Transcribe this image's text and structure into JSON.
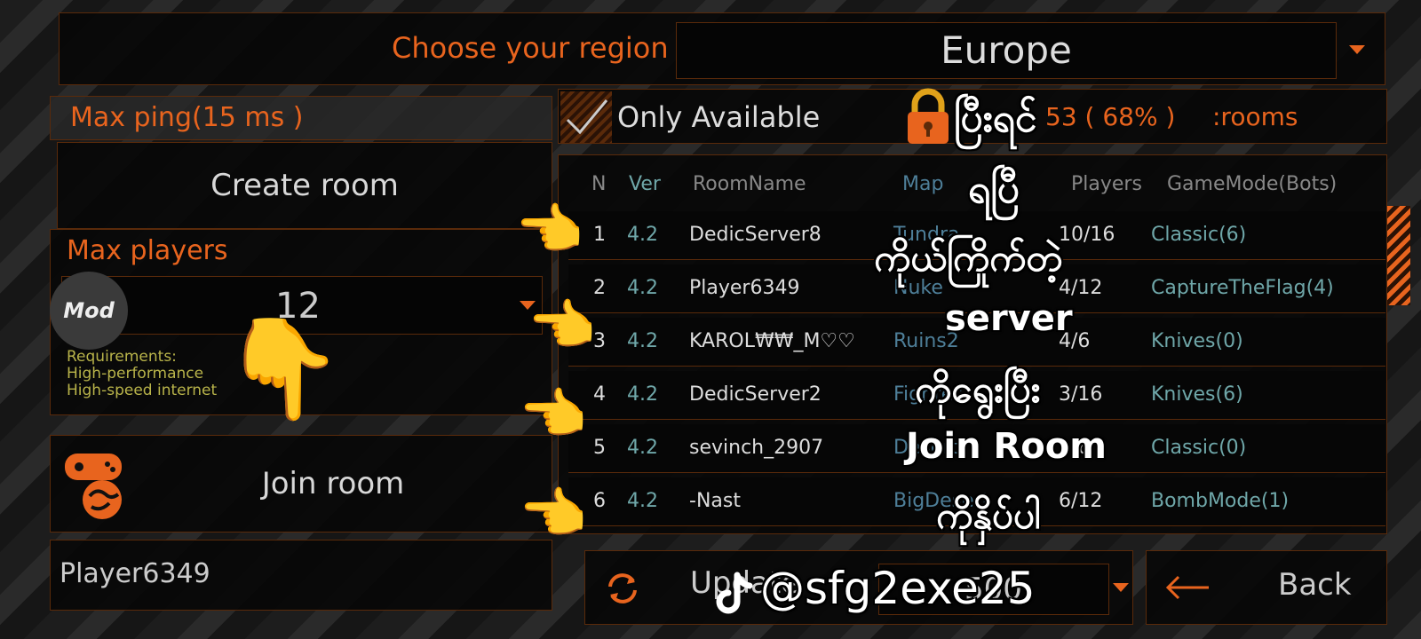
{
  "region": {
    "label": "Choose your region",
    "value": "Europe"
  },
  "max_ping": {
    "label": "Max ping(15 ms )"
  },
  "create_room": {
    "label": "Create room"
  },
  "max_players": {
    "label": "Max players",
    "value": "12"
  },
  "mod_badge": "Mod",
  "requirements": {
    "title": "Requirements:",
    "line1": "High-performance",
    "line2": "High-speed internet"
  },
  "join_room": {
    "label": "Join room"
  },
  "player_name": "Player6349",
  "filter": {
    "only_available": "Only Available",
    "checked": true
  },
  "rooms_summary": {
    "count": "53 ( 68% )",
    "suffix": ":rooms"
  },
  "table": {
    "headers": {
      "n": "N",
      "ver": "Ver",
      "room": "RoomName",
      "map": "Map",
      "players": "Players",
      "mode": "GameMode(Bots)"
    },
    "rows": [
      {
        "n": "1",
        "ver": "4.2",
        "room": "DedicServer8",
        "map": "Tundra",
        "players": "10/16",
        "mode": "Classic(6)"
      },
      {
        "n": "2",
        "ver": "4.2",
        "room": "Player6349",
        "map": "Nuke",
        "players": "4/12",
        "mode": "CaptureTheFlag(4)"
      },
      {
        "n": "3",
        "ver": "4.2",
        "room": "KAROL₩₩_M♡♡",
        "map": "Ruins2",
        "players": "4/6",
        "mode": "Knives(0)"
      },
      {
        "n": "4",
        "ver": "4.2",
        "room": "DedicServer2",
        "map": "Fighter",
        "players": "3/16",
        "mode": "Knives(6)"
      },
      {
        "n": "5",
        "ver": "4.2",
        "room": "sevinch_2907",
        "map": "Desert",
        "players": "1/6",
        "mode": "Classic(0)"
      },
      {
        "n": "6",
        "ver": "4.2",
        "room": "-Nast",
        "map": "BigDesert",
        "players": "6/12",
        "mode": "BombMode(1)"
      }
    ]
  },
  "update": {
    "label": "Update",
    "value": "500"
  },
  "back": {
    "label": "Back"
  },
  "overlay": {
    "line1": "ပြီးရင်",
    "line2": "ရပြီ",
    "line3": "ကိုယ်ကြိုက်တဲ့",
    "line4": "server",
    "line5": "ကိုရွေးပြီး",
    "line6": "Join Room",
    "line7": "ကိုနှိပ်ပါ",
    "watermark": "@sfg2exe25"
  },
  "icons": {
    "lock": "lock-icon",
    "pointing_hand": "pointing-hand-icon",
    "gamepad": "gamepad-globe-icon",
    "refresh": "refresh-icon",
    "back_arrow": "arrow-left-icon",
    "tiktok": "tiktok-logo"
  },
  "colors": {
    "accent": "#e8641e",
    "teal": "#6fa7a9",
    "map_blue": "#4e7f99",
    "req_yellow": "#b9b44a"
  }
}
